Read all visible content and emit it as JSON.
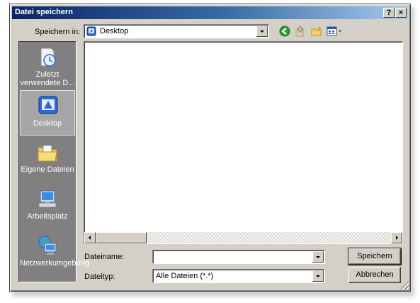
{
  "window": {
    "title": "Datei speichern",
    "help_button": "?",
    "close_button": "×"
  },
  "location": {
    "label": "Speichern in:",
    "value": "Desktop"
  },
  "toolbar": {
    "icons": [
      "back-icon",
      "up-folder-icon",
      "new-folder-icon",
      "view-menu-icon"
    ]
  },
  "places": [
    {
      "label": "Zuletzt verwendete D...",
      "icon": "recent-documents-icon"
    },
    {
      "label": "Desktop",
      "icon": "desktop-icon"
    },
    {
      "label": "Eigene Dateien",
      "icon": "my-documents-icon"
    },
    {
      "label": "Arbeitsplatz",
      "icon": "my-computer-icon"
    },
    {
      "label": "Netzwerkumgebung",
      "icon": "network-places-icon"
    }
  ],
  "filename": {
    "label": "Dateiname:",
    "value": ""
  },
  "filetype": {
    "label": "Dateityp:",
    "value": "Alle Dateien (*.*)"
  },
  "buttons": {
    "save": "Speichern",
    "cancel": "Abbrechen"
  },
  "colors": {
    "titlebar_start": "#0a246a",
    "titlebar_end": "#a6caf0",
    "face": "#d4d0c8",
    "places_bg": "#808080"
  }
}
